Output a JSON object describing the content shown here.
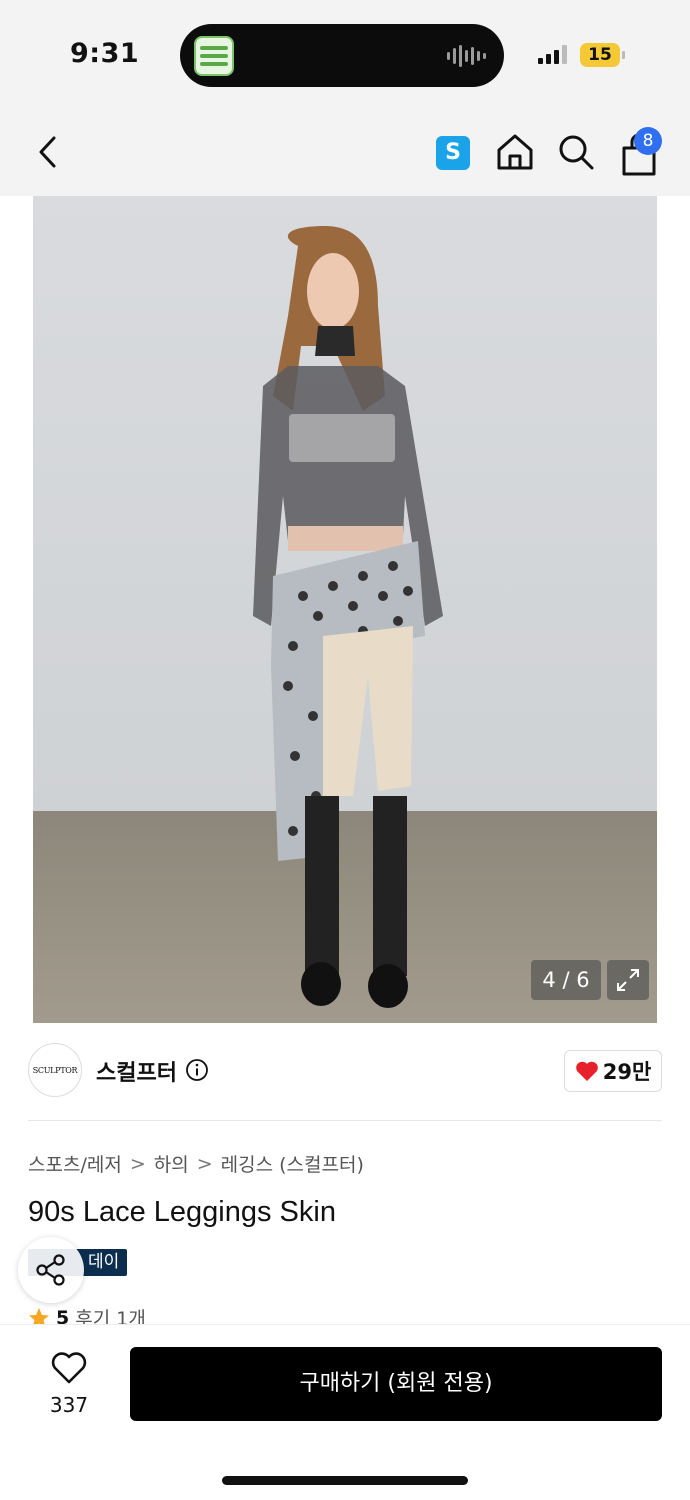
{
  "status_bar": {
    "time": "9:31",
    "battery": "15"
  },
  "header": {
    "back_icon": "chevron-left-icon",
    "s_badge": "S",
    "cart_count": "8"
  },
  "image": {
    "counter": "4 / 6",
    "expand_icon": "expand-icon"
  },
  "brand": {
    "logo_text": "SCULPTOR",
    "name": "스컬프터",
    "likes": "29만",
    "heart_color": "#e8202a"
  },
  "breadcrumb": [
    "스포츠/레저",
    "하의",
    "레깅스 (스컬프터)"
  ],
  "breadcrumb_sep": ">",
  "product": {
    "title": "90s Lace Leggings Skin",
    "tag": "데이",
    "rating_score": "5",
    "reviews": "후기 1개"
  },
  "bottom_bar": {
    "wish_count": "337",
    "buy_label": "구매하기 (회원 전용)"
  },
  "colors": {
    "cart_badge": "#2f6ff0",
    "s_badge": "#1aa3e8",
    "tag_bg": "#0b2e4f",
    "star": "#f5a623"
  }
}
